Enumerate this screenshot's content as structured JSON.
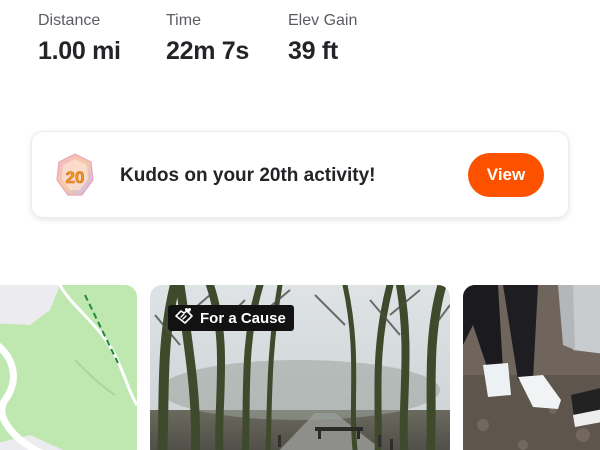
{
  "stats": [
    {
      "label": "Distance",
      "value": "1.00 mi"
    },
    {
      "label": "Time",
      "value": "22m 7s"
    },
    {
      "label": "Elev Gain",
      "value": "39 ft"
    }
  ],
  "kudos": {
    "badge_number": "20",
    "message": "Kudos on your 20th activity!",
    "view_label": "View"
  },
  "media": {
    "cause_tag": "For a Cause"
  },
  "colors": {
    "accent": "#fc5200",
    "text_primary": "#242428",
    "text_secondary": "#5b5b63",
    "map_green": "#bfe8b0",
    "tag_background": "#121212"
  },
  "icons": {
    "badge": "milestone-badge-icon",
    "cause": "handshake-heart-icon"
  }
}
